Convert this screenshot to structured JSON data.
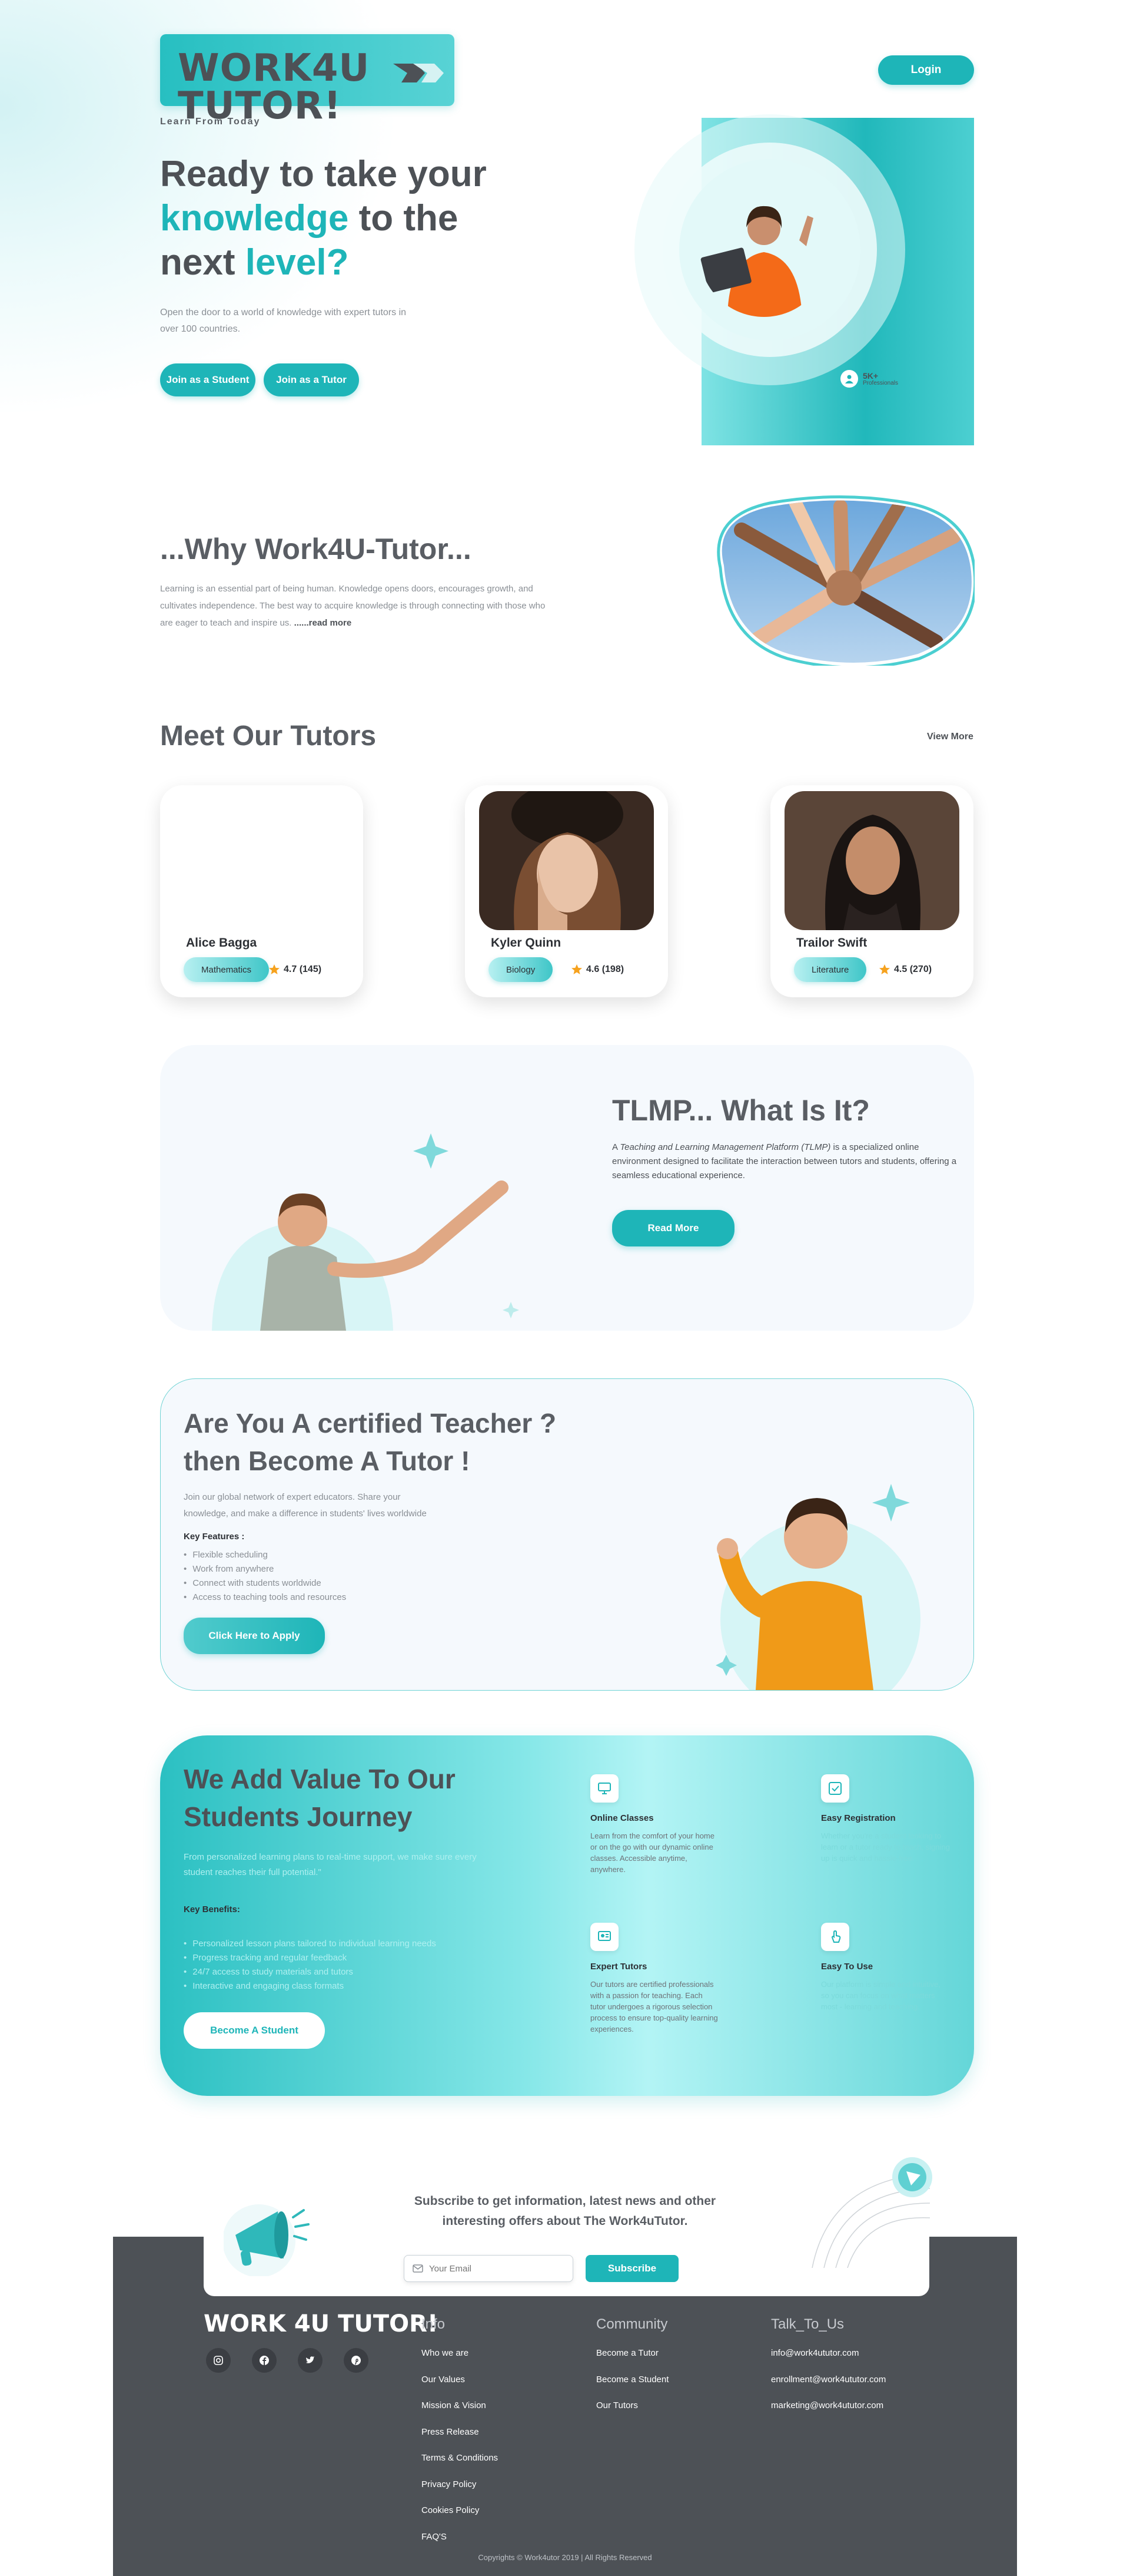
{
  "header": {
    "logo_text": "WORK4U TUTOR!",
    "tagline": "Learn From Today",
    "login_label": "Login"
  },
  "hero": {
    "title_line1": "Ready to take your",
    "title_line2_a": "knowledge",
    "title_line2_b": " to the",
    "title_line3_a": "next ",
    "title_line3_b": "level?",
    "subtitle": "Open the door to a world of knowledge with expert tutors in over 100 countries.",
    "join_student_label": "Join as a Student",
    "join_tutor_label": "Join as a Tutor",
    "stat_number": "5K+",
    "stat_label": "Professionals"
  },
  "why": {
    "title": "...Why Work4U-Tutor...",
    "text": "Learning is an essential part of being human. Knowledge opens doors, encourages growth, and cultivates independence. The best way to acquire knowledge is through connecting with those who are eager to teach and inspire us.",
    "read_more": "......read more"
  },
  "tutors": {
    "title": "Meet Our Tutors",
    "view_more": "View More",
    "items": [
      {
        "name": "Alice Bagga",
        "subject": "Mathematics",
        "rating": "4.7 (145)"
      },
      {
        "name": "Kyler Quinn",
        "subject": "Biology",
        "rating": "4.6 (198)"
      },
      {
        "name": "Trailor Swift",
        "subject": "Literature",
        "rating": "4.5 (270)"
      }
    ]
  },
  "tlmp": {
    "title": "TLMP... What Is It?",
    "text_prefix": "A ",
    "text_em": "Teaching and Learning Management Platform (TLMP)",
    "text_suffix": " is a specialized online environment designed to facilitate the interaction between tutors and students, offering a seamless educational experience.",
    "button": "Read More"
  },
  "teacher": {
    "title_line1": "Are You A certified Teacher ?",
    "title_line2": "then Become A Tutor !",
    "subtitle": "Join our global network of expert educators. Share your knowledge, and make a difference in students' lives worldwide",
    "features_label": "Key Features :",
    "features": [
      "Flexible scheduling",
      "Work from anywhere",
      "Connect with students worldwide",
      "Access to teaching tools and resources"
    ],
    "button": "Click Here to Apply"
  },
  "value": {
    "title_line1": "We Add Value To Our",
    "title_line2": "Students Journey",
    "subtitle": "From personalized learning plans to real-time support, we make sure every student reaches their full potential.\"",
    "benefits_label": "Key Benefits:",
    "benefits": [
      "Personalized lesson plans tailored to individual learning needs",
      "Progress tracking and regular feedback",
      "24/7 access to study materials and tutors",
      "Interactive and engaging class formats"
    ],
    "button": "Become A Student",
    "features": [
      {
        "icon": "monitor-icon",
        "title": "Online Classes",
        "text": "Learn from the comfort of your home or on the go with our dynamic online classes. Accessible anytime, anywhere."
      },
      {
        "icon": "registration-icon",
        "title": "Easy Registration",
        "text": "Whether you're a student looking to learn or a tutor ready to teach, signing up is quick and hassle-free."
      },
      {
        "icon": "expert-icon",
        "title": "Expert Tutors",
        "text": "Our tutors are certified professionals with a passion for teaching. Each tutor undergoes a rigorous selection process to ensure top-quality learning experiences."
      },
      {
        "icon": "touch-icon",
        "title": "Easy To Use",
        "text": "Our platform is simple and intuitive, so you can focus on what matters most - learning and teaching."
      }
    ]
  },
  "subscribe": {
    "title": "Subscribe to get information, latest news and other interesting offers about The Work4uTutor.",
    "email_placeholder": "Your Email",
    "button": "Subscribe"
  },
  "footer": {
    "logo_text": "WORK 4U TUTOR!",
    "info_title": "Info",
    "info_links": [
      "Who we are",
      "Our Values",
      "Mission & Vision",
      "Press Release",
      "Terms & Conditions",
      "Privacy Policy",
      "Cookies Policy",
      "FAQ'S"
    ],
    "community_title": "Community",
    "community_links": [
      "Become a Tutor",
      "Become a Student",
      "Our Tutors"
    ],
    "talk_title": "Talk_To_Us",
    "talk_links": [
      "info@work4ututor.com",
      "enrollment@work4ututor.com",
      "marketing@work4ututor.com"
    ],
    "copyright": "Copyrights © Work4utor 2019 | All Rights Reserved"
  },
  "colors": {
    "accent": "#1eb5b8",
    "dark": "#4d5156",
    "star": "#f6a21e"
  }
}
